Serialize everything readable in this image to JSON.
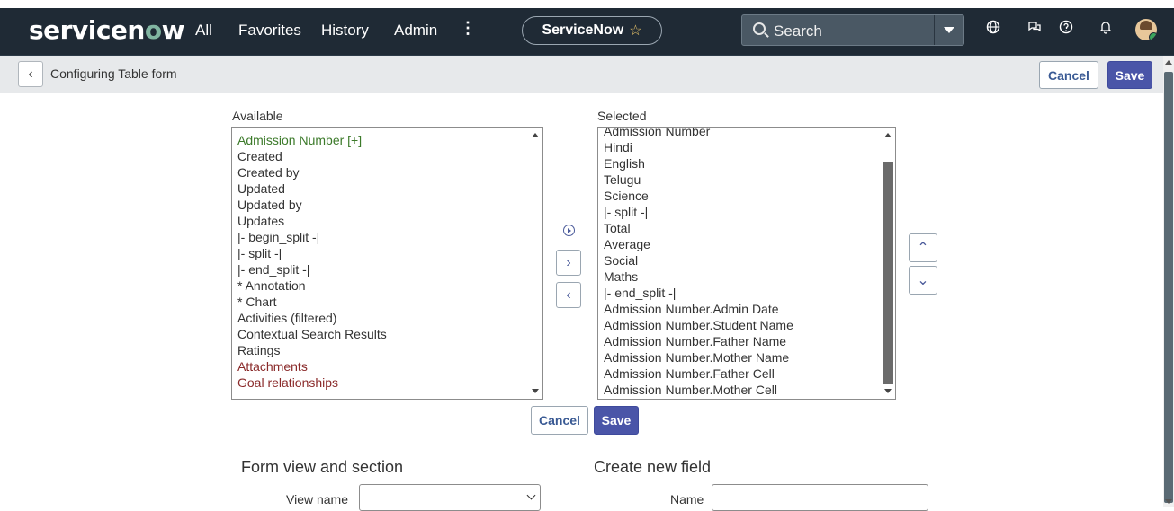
{
  "nav": {
    "logo_pre": "servicen",
    "logo_o": "o",
    "logo_post": "w",
    "links": [
      "All",
      "Favorites",
      "History",
      "Admin"
    ],
    "more": "⋮",
    "scope": "ServiceNow",
    "search_placeholder": "Search"
  },
  "header": {
    "title": "Configuring Table form",
    "cancel": "Cancel",
    "save": "Save"
  },
  "available": {
    "label": "Available",
    "items": [
      {
        "text": "Admission Number [+]",
        "color": "#3c7a2a"
      },
      {
        "text": "Created",
        "color": "#333333"
      },
      {
        "text": "Created by",
        "color": "#333333"
      },
      {
        "text": "Updated",
        "color": "#333333"
      },
      {
        "text": "Updated by",
        "color": "#333333"
      },
      {
        "text": "Updates",
        "color": "#333333"
      },
      {
        "text": "|- begin_split -|",
        "color": "#333333"
      },
      {
        "text": "|- split -|",
        "color": "#333333"
      },
      {
        "text": "|- end_split -|",
        "color": "#333333"
      },
      {
        "text": "* Annotation",
        "color": "#333333"
      },
      {
        "text": "* Chart",
        "color": "#333333"
      },
      {
        "text": "Activities (filtered)",
        "color": "#333333"
      },
      {
        "text": "Contextual Search Results",
        "color": "#333333"
      },
      {
        "text": "Ratings",
        "color": "#333333"
      },
      {
        "text": "Attachments",
        "color": "#8a2a2a"
      },
      {
        "text": "Goal relationships",
        "color": "#8a2a2a"
      }
    ]
  },
  "selected": {
    "label": "Selected",
    "items": [
      "Admission Number",
      "Hindi",
      "English",
      "Telugu",
      "Science",
      "|- split -|",
      "Total",
      "Average",
      "Social",
      "Maths",
      "|- end_split -|",
      "Admission Number.Admin Date",
      "Admission Number.Student Name",
      "Admission Number.Father Name",
      "Admission Number.Mother Name",
      "Admission Number.Father Cell",
      "Admission Number.Mother Cell"
    ]
  },
  "form_buttons": {
    "cancel": "Cancel",
    "save": "Save"
  },
  "form_view": {
    "heading": "Form view and section",
    "view_name_label": "View name",
    "view_name_value": ""
  },
  "new_field": {
    "heading": "Create new field",
    "name_label": "Name",
    "name_value": ""
  }
}
